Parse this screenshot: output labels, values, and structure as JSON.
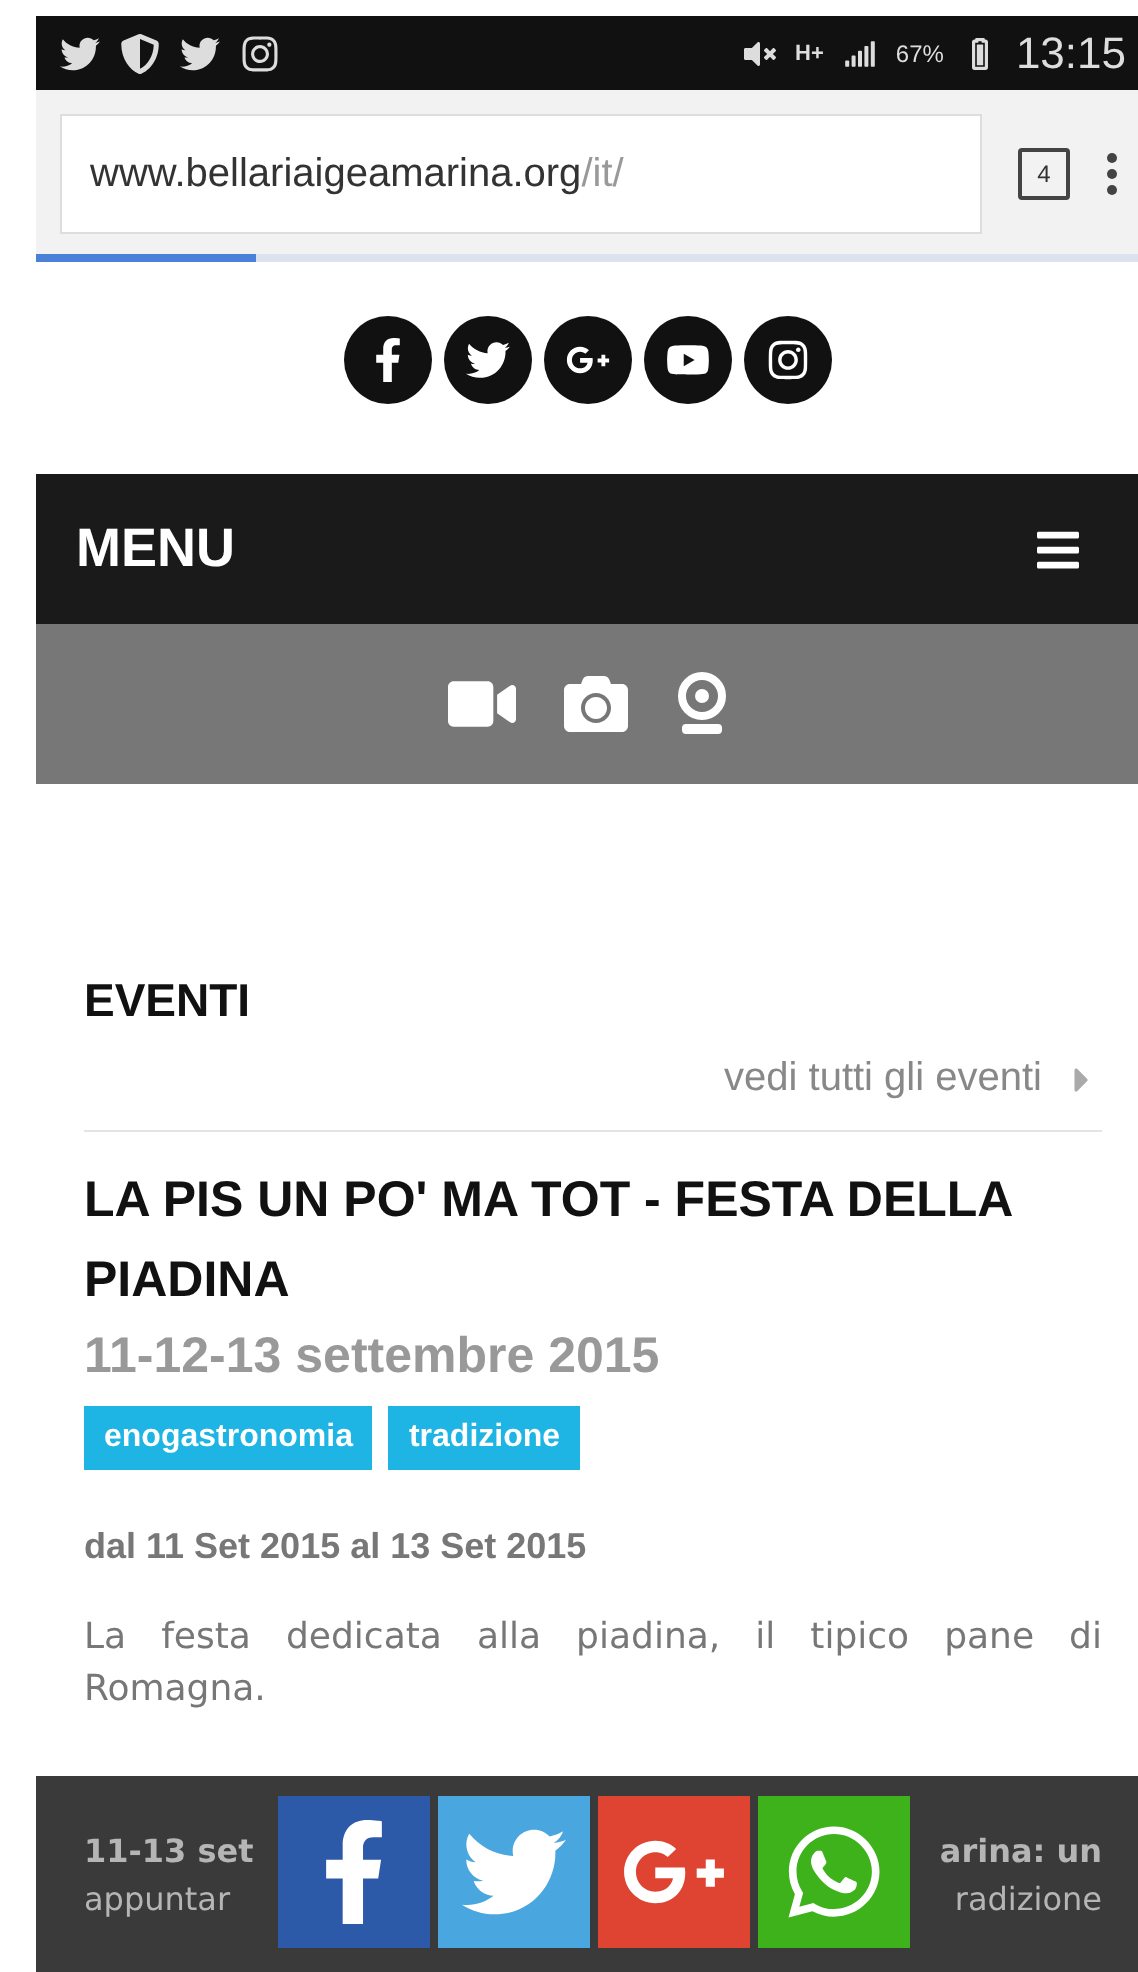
{
  "status_bar": {
    "network": "H+",
    "battery": "67%",
    "time": "13:15"
  },
  "browser": {
    "url_host": "www.bellariaigeamarina.org",
    "url_path": "/it/",
    "tab_count": "4",
    "load_progress": {
      "level": 0.2
    }
  },
  "menu": {
    "label": "MENU"
  },
  "events": {
    "title": "EVENTI",
    "see_all": "vedi tutti gli eventi",
    "event": {
      "title": "LA PIS UN PO' MA TOT - FESTA DELLA PIADINA",
      "date": "11-12-13 settembre 2015",
      "tags": [
        "enogastronomia",
        "tradizione"
      ],
      "range": "dal 11 Set 2015 al 13 Set 2015",
      "description": "La festa dedicata alla piadina, il tipico pane di Romagna.",
      "covered_lines": [
        {
          "left": "11-13 set",
          "right": "arina: un",
          "bold": true
        },
        {
          "left": "appuntar",
          "right": "radizione",
          "bold": false
        }
      ]
    }
  },
  "share_bar": {
    "buttons": [
      {
        "kind": "facebook"
      },
      {
        "kind": "twitter"
      },
      {
        "kind": "googleplus"
      },
      {
        "kind": "whatsapp"
      }
    ]
  }
}
